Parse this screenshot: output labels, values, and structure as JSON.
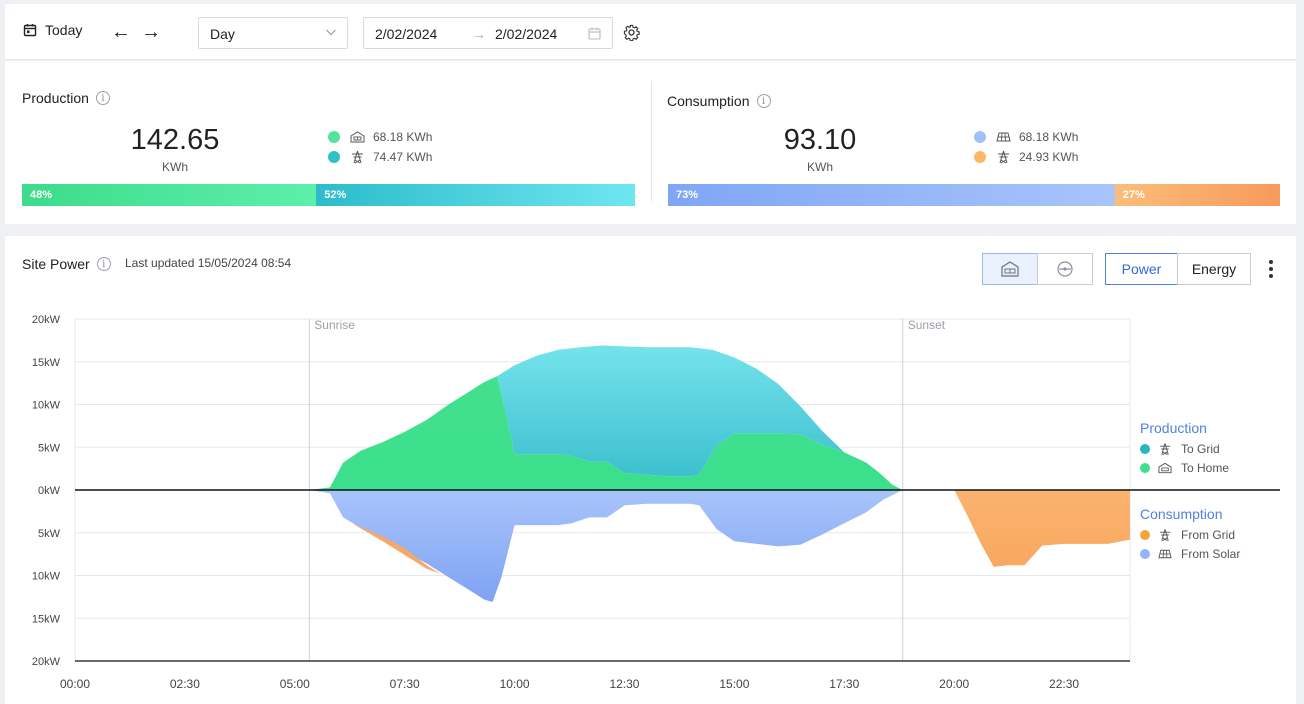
{
  "toolbar": {
    "today_label": "Today",
    "period_select": "Day",
    "date_from": "2/02/2024",
    "date_to": "2/02/2024",
    "range_arrow": "→"
  },
  "production": {
    "title": "Production",
    "total": "142.65",
    "unit": "KWh",
    "items": [
      {
        "value": "68.18 KWh",
        "color": "#4ee59a",
        "icon": "house-solar-icon"
      },
      {
        "value": "74.47 KWh",
        "color": "#30c1c8",
        "icon": "grid-tower-icon"
      }
    ],
    "split": [
      {
        "label": "48%",
        "fraction": 0.48
      },
      {
        "label": "52%",
        "fraction": 0.52
      }
    ]
  },
  "consumption": {
    "title": "Consumption",
    "total": "93.10",
    "unit": "KWh",
    "items": [
      {
        "value": "68.18 KWh",
        "color": "#a3c0fb",
        "icon": "solar-panel-icon"
      },
      {
        "value": "24.93 KWh",
        "color": "#fbb866",
        "icon": "grid-tower-icon"
      }
    ],
    "split": [
      {
        "label": "73%",
        "fraction": 0.73
      },
      {
        "label": "27%",
        "fraction": 0.27
      }
    ]
  },
  "site_power": {
    "title": "Site Power",
    "last_updated": "Last updated 15/05/2024 08:54",
    "toggle": {
      "power": "Power",
      "energy": "Energy",
      "active": "Power"
    }
  },
  "chart_data": {
    "type": "area",
    "x_ticks": [
      "00:00",
      "02:30",
      "05:00",
      "07:30",
      "10:00",
      "12:30",
      "15:00",
      "17:30",
      "20:00",
      "22:30"
    ],
    "x_range_hours": [
      0,
      24
    ],
    "y_tick_labels": [
      "20kW",
      "15kW",
      "10kW",
      "5kW",
      "0kW",
      "5kW",
      "10kW",
      "15kW",
      "20kW"
    ],
    "y_range_kw": [
      -20,
      20
    ],
    "markers": [
      {
        "label": "Sunrise",
        "x": 5.33
      },
      {
        "label": "Sunset",
        "x": 18.83
      }
    ],
    "legend": {
      "production_title": "Production",
      "consumption_title": "Consumption",
      "production": [
        {
          "name": "To Grid",
          "color": "#23b8c2",
          "icon": "grid-tower-icon"
        },
        {
          "name": "To Home",
          "color": "#3fe08b",
          "icon": "house-solar-icon"
        }
      ],
      "consumption": [
        {
          "name": "From Grid",
          "color": "#f7a53a",
          "icon": "grid-tower-icon"
        },
        {
          "name": "From Solar",
          "color": "#93b4f9",
          "icon": "solar-panel-icon"
        }
      ]
    },
    "series": {
      "to_home": [
        [
          5.33,
          0
        ],
        [
          5.8,
          0.3
        ],
        [
          6.1,
          3.2
        ],
        [
          6.5,
          4.6
        ],
        [
          7,
          5.6
        ],
        [
          7.5,
          6.8
        ],
        [
          8,
          8.2
        ],
        [
          8.5,
          10
        ],
        [
          9,
          11.6
        ],
        [
          9.3,
          12.6
        ],
        [
          9.6,
          13.3
        ],
        [
          9.8,
          9
        ],
        [
          10,
          4.2
        ],
        [
          11,
          4.2
        ],
        [
          11.3,
          4
        ],
        [
          11.7,
          3.3
        ],
        [
          12.1,
          3.3
        ],
        [
          12.5,
          2
        ],
        [
          13,
          1.8
        ],
        [
          13.5,
          1.6
        ],
        [
          14,
          1.6
        ],
        [
          14.2,
          1.8
        ],
        [
          14.6,
          5.2
        ],
        [
          15,
          6.6
        ],
        [
          16,
          6.6
        ],
        [
          16.5,
          6.5
        ],
        [
          17,
          5.3
        ],
        [
          17.5,
          4.4
        ],
        [
          18,
          3.2
        ],
        [
          18.3,
          2
        ],
        [
          18.6,
          0.6
        ],
        [
          18.83,
          0
        ]
      ],
      "to_grid_top": [
        [
          9.6,
          13.3
        ],
        [
          10,
          14.6
        ],
        [
          10.5,
          15.7
        ],
        [
          11,
          16.4
        ],
        [
          11.5,
          16.7
        ],
        [
          12,
          16.9
        ],
        [
          12.5,
          16.8
        ],
        [
          13,
          16.7
        ],
        [
          13.5,
          16.7
        ],
        [
          14,
          16.7
        ],
        [
          14.5,
          16.4
        ],
        [
          15,
          15.5
        ],
        [
          15.5,
          14.2
        ],
        [
          16,
          12.4
        ],
        [
          16.5,
          9.8
        ],
        [
          17,
          6.9
        ],
        [
          17.5,
          4.4
        ],
        [
          18,
          3.2
        ],
        [
          18.3,
          2
        ],
        [
          18.6,
          0.6
        ],
        [
          18.83,
          0
        ]
      ],
      "from_solar": [
        [
          5.33,
          0
        ],
        [
          5.8,
          -0.4
        ],
        [
          6.1,
          -3.2
        ],
        [
          6.5,
          -4.4
        ],
        [
          7,
          -5.6
        ],
        [
          7.5,
          -7.2
        ],
        [
          8,
          -8.6
        ],
        [
          8.5,
          -10.2
        ],
        [
          9,
          -11.8
        ],
        [
          9.3,
          -12.8
        ],
        [
          9.5,
          -13.1
        ],
        [
          9.7,
          -10.2
        ],
        [
          10,
          -4.1
        ],
        [
          11,
          -4.1
        ],
        [
          11.3,
          -3.9
        ],
        [
          11.7,
          -3.2
        ],
        [
          12.1,
          -3.2
        ],
        [
          12.5,
          -1.8
        ],
        [
          13,
          -1.6
        ],
        [
          14,
          -1.6
        ],
        [
          14.2,
          -1.8
        ],
        [
          14.6,
          -4.6
        ],
        [
          15,
          -6
        ],
        [
          16,
          -6.6
        ],
        [
          16.5,
          -6.4
        ],
        [
          17,
          -5.2
        ],
        [
          17.5,
          -3.9
        ],
        [
          18,
          -2.6
        ],
        [
          18.4,
          -1.1
        ],
        [
          18.83,
          0
        ]
      ],
      "from_grid_day": [
        [
          6.3,
          -3.9
        ],
        [
          7,
          -5.4
        ],
        [
          7.5,
          -6.8
        ],
        [
          8,
          -8.8
        ],
        [
          8.3,
          -9.8
        ],
        [
          8,
          -9.2
        ],
        [
          7.5,
          -7.6
        ],
        [
          7,
          -6
        ]
      ],
      "from_grid_evening": [
        [
          20,
          0
        ],
        [
          20.3,
          -3
        ],
        [
          20.6,
          -6.2
        ],
        [
          20.9,
          -9
        ],
        [
          21.2,
          -8.8
        ],
        [
          21.6,
          -8.8
        ],
        [
          22,
          -6.5
        ],
        [
          22.5,
          -6.3
        ],
        [
          23,
          -6.3
        ],
        [
          23.5,
          -6.3
        ],
        [
          24,
          -5.8
        ],
        [
          24,
          0
        ]
      ]
    }
  }
}
